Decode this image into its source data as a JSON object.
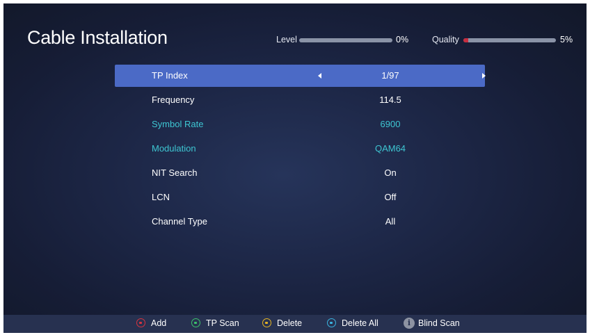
{
  "screen": {
    "title": "Cable Installation"
  },
  "signal": {
    "level_label": "Level",
    "level_value": "0%",
    "level_fraction": 0.0,
    "quality_label": "Quality",
    "quality_value": "5%",
    "quality_fraction": 0.05,
    "fill_color": "#c62d3f",
    "track_color": "#8a93a7"
  },
  "menu": {
    "selected_color": "#4b6ac6",
    "highlight_color": "#3ec6d2",
    "rows": [
      {
        "label": "TP Index",
        "value": "1/97",
        "selected": true,
        "arrows": [
          "left-arrow-icon",
          "right-arrow-icon"
        ]
      },
      {
        "label": "Frequency",
        "value": "114.5"
      },
      {
        "label": "Symbol Rate",
        "value": "6900",
        "highlighted": true
      },
      {
        "label": "Modulation",
        "value": "QAM64",
        "highlighted": true
      },
      {
        "label": "NIT Search",
        "value": "On"
      },
      {
        "label": "LCN",
        "value": "Off"
      },
      {
        "label": "Channel Type",
        "value": "All"
      }
    ]
  },
  "footer": {
    "hints": [
      {
        "icon": "red-button-icon",
        "color": "#d8333f",
        "label": "Add"
      },
      {
        "icon": "green-button-icon",
        "color": "#3cc36a",
        "label": "TP Scan"
      },
      {
        "icon": "yellow-button-icon",
        "color": "#e6b523",
        "label": "Delete"
      },
      {
        "icon": "blue-button-icon",
        "color": "#3ab4e0",
        "label": "Delete All"
      },
      {
        "icon": "info-button-icon",
        "glyph": "i",
        "label": "Blind Scan"
      }
    ]
  }
}
